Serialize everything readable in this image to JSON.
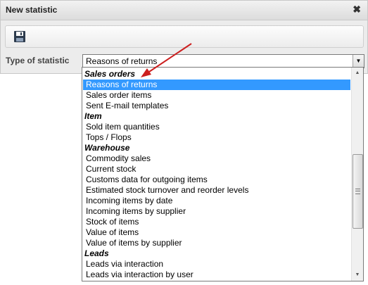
{
  "dialog": {
    "title": "New statistic",
    "close_glyph": "✖",
    "toolbar": {
      "save_icon": "floppy-disk-icon"
    }
  },
  "field": {
    "label": "Type of statistic",
    "selected_value": "Reasons of returns"
  },
  "dropdown": {
    "options": [
      {
        "text": "Sales orders",
        "type": "group"
      },
      {
        "text": "Reasons of returns",
        "type": "option",
        "selected": true
      },
      {
        "text": "Sales order items",
        "type": "option"
      },
      {
        "text": "Sent E-mail templates",
        "type": "option"
      },
      {
        "text": "Item",
        "type": "group"
      },
      {
        "text": "Sold item quantities",
        "type": "option"
      },
      {
        "text": "Tops / Flops",
        "type": "option"
      },
      {
        "text": "Warehouse",
        "type": "group"
      },
      {
        "text": "Commodity sales",
        "type": "option"
      },
      {
        "text": "Current stock",
        "type": "option"
      },
      {
        "text": "Customs data for outgoing items",
        "type": "option"
      },
      {
        "text": "Estimated stock turnover and reorder levels",
        "type": "option"
      },
      {
        "text": "Incoming items by date",
        "type": "option"
      },
      {
        "text": "Incoming items by supplier",
        "type": "option"
      },
      {
        "text": "Stock of items",
        "type": "option"
      },
      {
        "text": "Value of items",
        "type": "option"
      },
      {
        "text": "Value of items by supplier",
        "type": "option"
      },
      {
        "text": "Leads",
        "type": "group"
      },
      {
        "text": "Leads via interaction",
        "type": "option"
      },
      {
        "text": "Leads via interaction by user",
        "type": "option"
      }
    ],
    "selected_color": "#3399ff"
  },
  "annotation": {
    "arrow_color": "#cc1f1f"
  }
}
